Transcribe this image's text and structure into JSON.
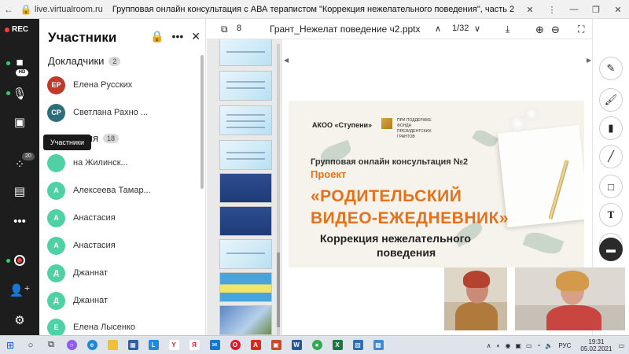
{
  "browser": {
    "url": "live.virtualroom.ru",
    "page_title": "Групповая онлайн консультация с АВА терапистом \"Коррекция нежелательного поведения\", часть 2"
  },
  "toolbar": {
    "rec_label": "REC",
    "hd_label": "HD",
    "participants_badge": "20"
  },
  "tooltip": {
    "text": "Участники"
  },
  "panel": {
    "title": "Участники",
    "speakers": {
      "label": "Докладчики",
      "count": "2"
    },
    "audience": {
      "label": "Аудитория",
      "count": "18"
    },
    "people": [
      {
        "initials": "ЕР",
        "name": "Елена Русских",
        "color": "#c0392b"
      },
      {
        "initials": "СР",
        "name": "Светлана Рахно ...",
        "color": "#2c6e7a"
      },
      {
        "initials": "",
        "name": "на Жилинск...",
        "color": "#4fd1a5"
      },
      {
        "initials": "А",
        "name": "Алексеева Тамар...",
        "color": "#4fd1a5"
      },
      {
        "initials": "А",
        "name": "Анастасия",
        "color": "#4fd1a5"
      },
      {
        "initials": "А",
        "name": "Анастасия",
        "color": "#4fd1a5"
      },
      {
        "initials": "Д",
        "name": "Джаннат",
        "color": "#4fd1a5"
      },
      {
        "initials": "Д",
        "name": "Джаннат",
        "color": "#4fd1a5"
      },
      {
        "initials": "Е",
        "name": "Елена Лысенко",
        "color": "#4fd1a5"
      }
    ]
  },
  "doc": {
    "thumb_count": "8",
    "filename": "Грант_Нежелат поведение ч2.pptx",
    "page_indicator": "1/32"
  },
  "slide": {
    "org": "АКОО «Ступени»",
    "fund": "ПРИ ПОДДЕРЖКЕ ФОНДА ПРЕЗИДЕНТСКИХ ГРАНТОВ",
    "heading": "Групповая онлайн консультация №2",
    "project": "Проект",
    "title_line1": "«РОДИТЕЛЬСКИЙ",
    "title_line2": "ВИДЕО-ЕЖЕДНЕВНИК»",
    "subtitle_line1": "Коррекция нежелательного",
    "subtitle_line2": "поведения"
  },
  "taskbar": {
    "lang": "РУС",
    "time": "19:31",
    "date": "05.02.2021"
  }
}
